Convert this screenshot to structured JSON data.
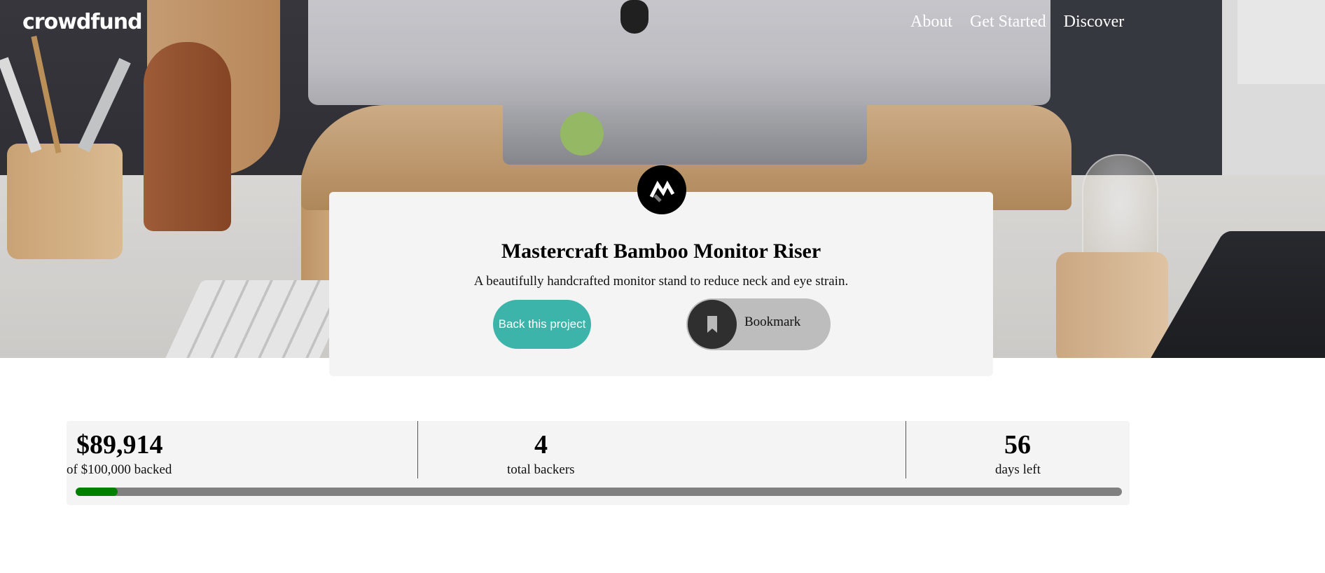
{
  "nav": {
    "logo": "crowdfund",
    "links": [
      "About",
      "Get Started",
      "Discover"
    ]
  },
  "project": {
    "title": "Mastercraft Bamboo Monitor Riser",
    "description": "A beautifully handcrafted monitor stand to reduce neck and eye strain.",
    "back_label": "Back this project",
    "bookmark_label": "Bookmark",
    "logo_icon": "mastercraft-logo-icon"
  },
  "stats": {
    "backed_amount": "$89,914",
    "backed_label": "of $100,000 backed",
    "backers_count": "4",
    "backers_label": "total backers",
    "days_left": "56",
    "days_label": "days left",
    "progress_fraction": 0.04
  },
  "colors": {
    "accent": "#3cb4aa",
    "progress_fill": "#008000",
    "progress_track": "#808080"
  }
}
